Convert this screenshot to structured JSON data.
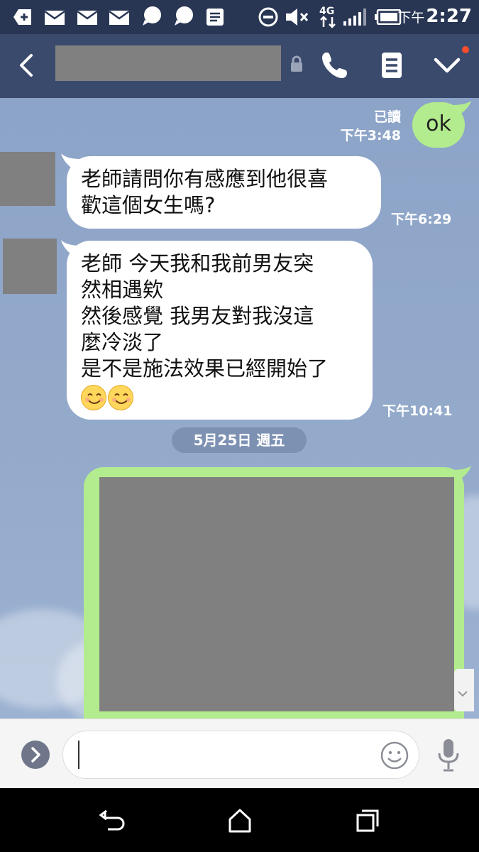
{
  "status_bar": {
    "time_prefix": "下午",
    "time": "2:27",
    "network": "4G"
  },
  "header": {
    "contact_name": "",
    "icons": [
      "back-chevron-icon",
      "lock-icon",
      "phone-icon",
      "notes-icon",
      "chevron-down-icon"
    ]
  },
  "messages": [
    {
      "side": "right",
      "text": "ok",
      "read": "已讀",
      "time_prefix": "下午",
      "time": "3:48"
    },
    {
      "side": "left",
      "lines": [
        "老師請問你有感應到他很喜",
        "歡這個女生嗎?"
      ],
      "time_prefix": "下午",
      "time": "6:29"
    },
    {
      "side": "left",
      "lines": [
        "老師 今天我和我前男友突",
        "然相遇欸",
        "然後感覺 我男友對我沒這",
        "麼冷淡了",
        "是不是施法效果已經開始了"
      ],
      "emoji": "smiling-face-icon",
      "emoji_count": 2,
      "time_prefix": "下午",
      "time": "10:41"
    }
  ],
  "date_separator": "5月25日 週五",
  "input": {
    "value": "",
    "placeholder": ""
  },
  "colors": {
    "status_bar": "#283654",
    "header": "#3a4a6c",
    "chat_bg": "#8ca4c8",
    "own_bubble": "#b3ec8e",
    "other_bubble": "#ffffff"
  }
}
